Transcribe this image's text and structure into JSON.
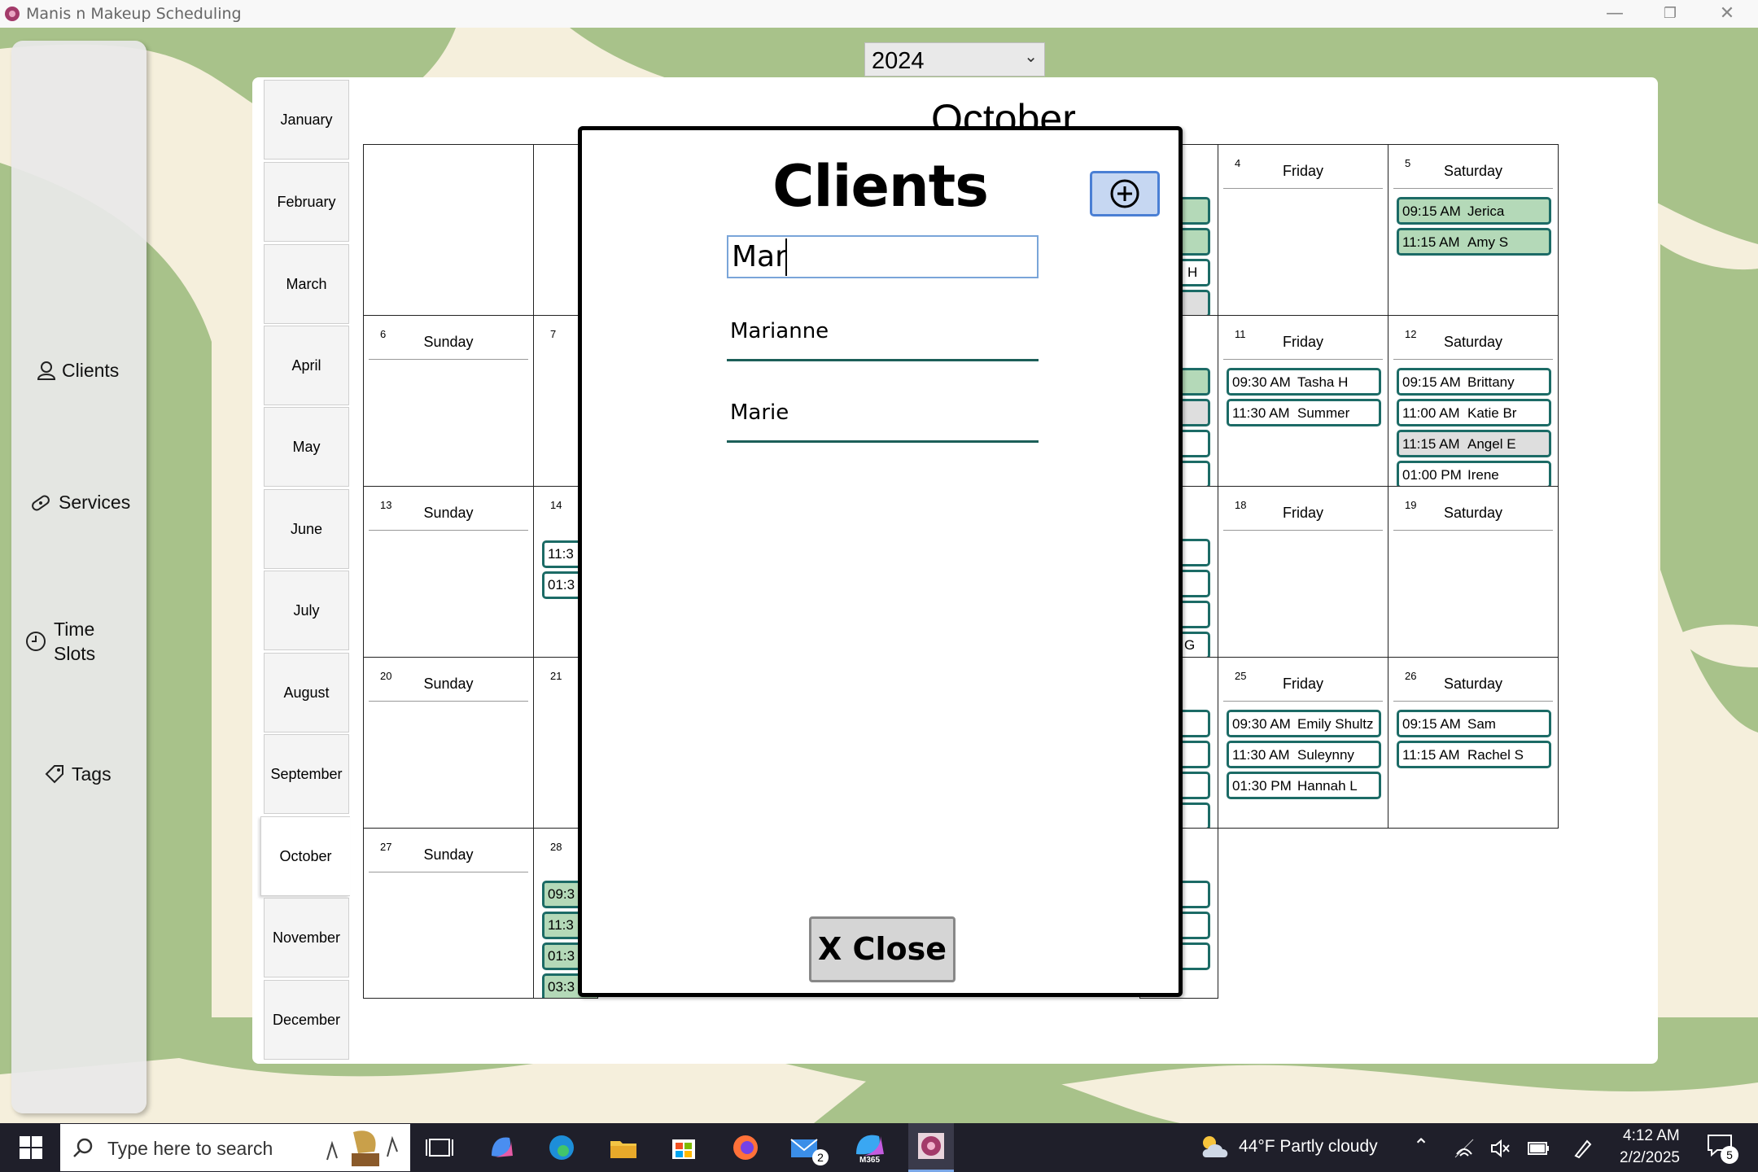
{
  "window": {
    "title": "Manis n Makeup Scheduling"
  },
  "sidebar": {
    "items": [
      {
        "label": "Clients",
        "icon": "person-icon"
      },
      {
        "label": "Services",
        "icon": "bandage-icon"
      },
      {
        "label": "Time",
        "label2": "Slots",
        "icon": "clock-icon"
      },
      {
        "label": "Tags",
        "icon": "tag-icon"
      }
    ]
  },
  "year_select": {
    "value": "2024"
  },
  "months": [
    "January",
    "February",
    "March",
    "April",
    "May",
    "June",
    "July",
    "August",
    "September",
    "October",
    "November",
    "December"
  ],
  "selected_month": "October",
  "calendar": {
    "title": "October",
    "weeks": [
      {
        "sun": "",
        "mon": "",
        "fri_num": "4",
        "fri": "Friday",
        "sat_num": "5",
        "sat": "Saturday",
        "fri_appts": [],
        "sat_appts": [
          {
            "time": "09:15 AM",
            "name": "Jerica",
            "style": "green"
          },
          {
            "time": "11:15 AM",
            "name": "Amy S",
            "style": "green"
          }
        ]
      },
      {
        "sun_num": "6",
        "sun": "Sunday",
        "mon_num": "7",
        "fri_num": "11",
        "fri": "Friday",
        "sat_num": "12",
        "sat": "Saturday",
        "fri_appts": [
          {
            "time": "09:30 AM",
            "name": "Tasha H",
            "style": "white"
          },
          {
            "time": "11:30 AM",
            "name": "Summer",
            "style": "white"
          }
        ],
        "sat_appts": [
          {
            "time": "09:15 AM",
            "name": "Brittany",
            "style": "white"
          },
          {
            "time": "11:00 AM",
            "name": "Katie Br",
            "style": "white"
          },
          {
            "time": "11:15 AM",
            "name": "Angel E",
            "style": "gray"
          },
          {
            "time": "01:00 PM",
            "name": "Irene",
            "style": "white"
          }
        ]
      },
      {
        "sun_num": "13",
        "sun": "Sunday",
        "mon_num": "14",
        "fri_num": "18",
        "fri": "Friday",
        "sat_num": "19",
        "sat": "Saturday",
        "mon_appts": [
          {
            "time": "11:3"
          },
          {
            "time": "01:3"
          }
        ]
      },
      {
        "sun_num": "20",
        "sun": "Sunday",
        "mon_num": "21",
        "fri_num": "25",
        "fri": "Friday",
        "sat_num": "26",
        "sat": "Saturday",
        "fri_appts": [
          {
            "time": "09:30 AM",
            "name": "Emily Shultz",
            "style": "white"
          },
          {
            "time": "11:30 AM",
            "name": "Suleynny",
            "style": "white"
          },
          {
            "time": "01:30 PM",
            "name": "Hannah L",
            "style": "white"
          }
        ],
        "sat_appts": [
          {
            "time": "09:15 AM",
            "name": "Sam",
            "style": "white"
          },
          {
            "time": "11:15 AM",
            "name": "Rachel S",
            "style": "white"
          }
        ]
      },
      {
        "sun_num": "27",
        "sun": "Sunday",
        "mon_num": "28",
        "mon_appts": [
          {
            "time": "09:3"
          },
          {
            "time": "11:3"
          },
          {
            "time": "01:3"
          },
          {
            "time": "03:3"
          }
        ]
      }
    ],
    "stub_labels": {
      "w1": "H",
      "w3": "G"
    }
  },
  "modal": {
    "title": "Clients",
    "search_value": "Mar",
    "results": [
      "Marianne",
      "Marie"
    ],
    "close_label": "X Close"
  },
  "taskbar": {
    "search_placeholder": "Type here to search",
    "weather": "44°F  Partly cloudy",
    "time": "4:12 AM",
    "date": "2/2/2025",
    "mail_badge": "2",
    "m365_label": "M365",
    "notif_count": "5"
  },
  "colors": {
    "accent": "#1c6b66",
    "green_bg": "#a8c28a",
    "cream": "#f5efdc",
    "appt_green": "#b4d9b8"
  }
}
